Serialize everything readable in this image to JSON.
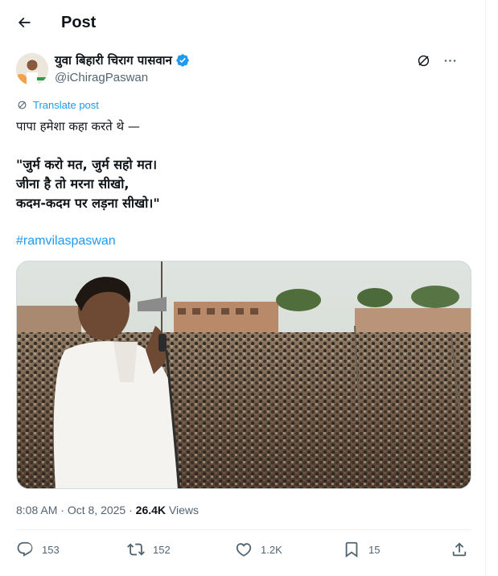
{
  "header": {
    "title": "Post",
    "back_icon": "arrow-left-icon"
  },
  "author": {
    "display_name": "युवा बिहारी चिराग पासवान",
    "handle": "@iChiragPaswan",
    "verified_color": "#1d9bf0"
  },
  "top_actions": {
    "grok_icon": "grok-icon",
    "more_icon": "more-icon"
  },
  "translate": {
    "label": "Translate post",
    "icon": "translate-icon"
  },
  "post": {
    "lines": [
      "पापा हमेशा कहा करते थे —",
      "",
      "\"जुर्म करो मत, जुर्म सहो मत।",
      "जीना है तो मरना सीखो,",
      "कदम-कदम पर लड़ना सीखो।\""
    ],
    "hashtag": "#ramvilaspaswan"
  },
  "meta": {
    "time": "8:08 AM",
    "dot": "·",
    "date": "Oct 8, 2025",
    "views_count": "26.4K",
    "views_label": "Views"
  },
  "actions": {
    "replies": "153",
    "reposts": "152",
    "likes": "1.2K",
    "bookmarks": "15"
  },
  "colors": {
    "accent": "#1d9bf0",
    "muted": "#536471",
    "text": "#0f1419",
    "border": "#cfd9de"
  }
}
